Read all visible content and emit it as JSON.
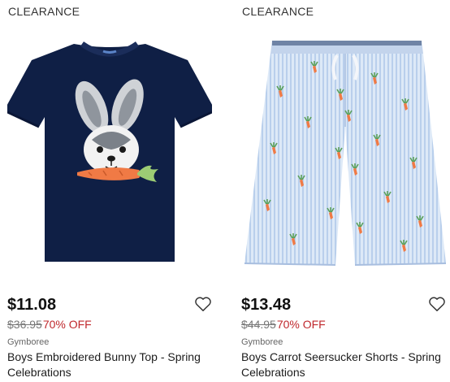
{
  "products": [
    {
      "badge": "CLEARANCE",
      "price": "$11.08",
      "original_price": "$36.95",
      "discount": "70% OFF",
      "brand": "Gymboree",
      "title": "Boys Embroidered Bunny Top - Spring Celebrations",
      "image": "navy-bunny-tshirt",
      "favorite_icon": "heart-outline-icon"
    },
    {
      "badge": "CLEARANCE",
      "price": "$13.48",
      "original_price": "$44.95",
      "discount": "70% OFF",
      "brand": "Gymboree",
      "title": "Boys Carrot Seersucker Shorts - Spring Celebrations",
      "image": "seersucker-carrot-shorts",
      "favorite_icon": "heart-outline-icon"
    }
  ],
  "colors": {
    "sale_red": "#c0282d",
    "strike_gray": "#777777",
    "shirt_navy": "#0f1f45",
    "shorts_blue": "#c9dcf2",
    "carrot_orange": "#f07a45"
  }
}
